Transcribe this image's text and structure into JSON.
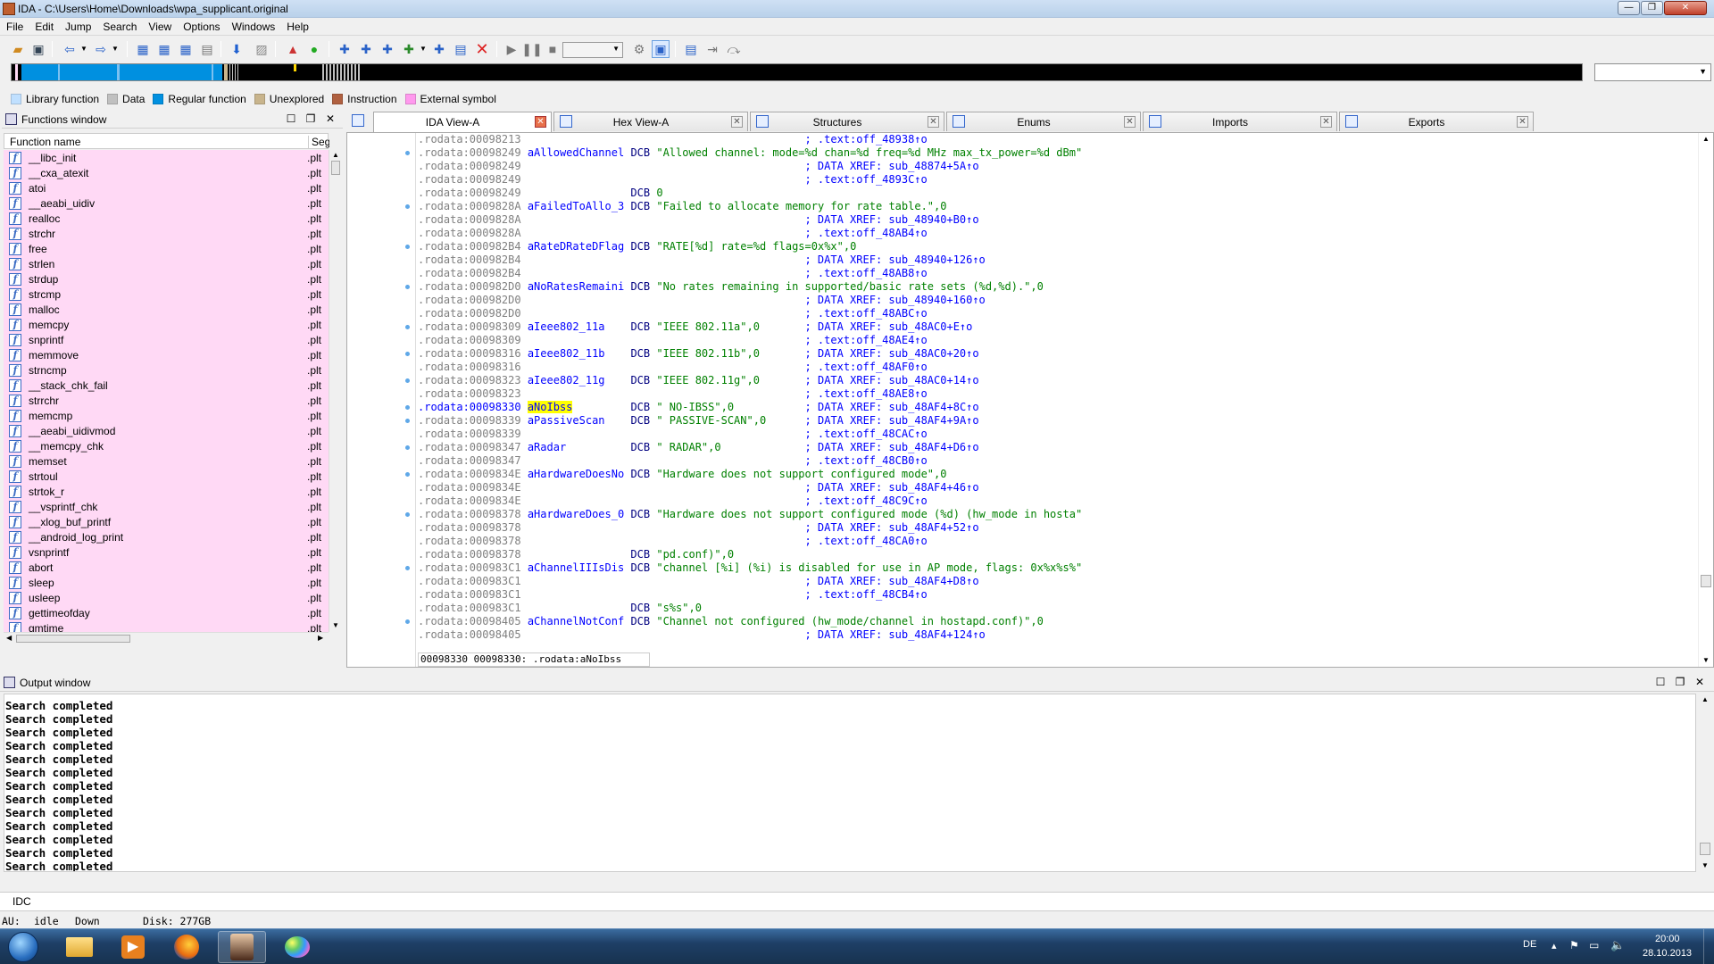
{
  "window": {
    "title": "IDA - C:\\Users\\Home\\Downloads\\wpa_supplicant.original",
    "minimize": "—",
    "maximize": "❐",
    "close": "✕"
  },
  "menu": [
    "File",
    "Edit",
    "Jump",
    "Search",
    "View",
    "Options",
    "Windows",
    "Help"
  ],
  "legend": [
    {
      "label": "Library function",
      "color": "#c0e0ff"
    },
    {
      "label": "Data",
      "color": "#c0c0c0"
    },
    {
      "label": "Regular function",
      "color": "#0090e0"
    },
    {
      "label": "Unexplored",
      "color": "#c8b48c"
    },
    {
      "label": "Instruction",
      "color": "#b06040"
    },
    {
      "label": "External symbol",
      "color": "#ff99ee"
    }
  ],
  "functions_panel": {
    "title": "Functions window",
    "col_name": "Function name",
    "col_segment": "Segm",
    "items": [
      {
        "name": "__libc_init",
        "seg": ".plt"
      },
      {
        "name": "__cxa_atexit",
        "seg": ".plt"
      },
      {
        "name": "atoi",
        "seg": ".plt"
      },
      {
        "name": "__aeabi_uidiv",
        "seg": ".plt"
      },
      {
        "name": "realloc",
        "seg": ".plt"
      },
      {
        "name": "strchr",
        "seg": ".plt"
      },
      {
        "name": "free",
        "seg": ".plt"
      },
      {
        "name": "strlen",
        "seg": ".plt"
      },
      {
        "name": "strdup",
        "seg": ".plt"
      },
      {
        "name": "strcmp",
        "seg": ".plt"
      },
      {
        "name": "malloc",
        "seg": ".plt"
      },
      {
        "name": "memcpy",
        "seg": ".plt"
      },
      {
        "name": "snprintf",
        "seg": ".plt"
      },
      {
        "name": "memmove",
        "seg": ".plt"
      },
      {
        "name": "strncmp",
        "seg": ".plt"
      },
      {
        "name": "__stack_chk_fail",
        "seg": ".plt"
      },
      {
        "name": "strrchr",
        "seg": ".plt"
      },
      {
        "name": "memcmp",
        "seg": ".plt"
      },
      {
        "name": "__aeabi_uidivmod",
        "seg": ".plt"
      },
      {
        "name": "__memcpy_chk",
        "seg": ".plt"
      },
      {
        "name": "memset",
        "seg": ".plt"
      },
      {
        "name": "strtoul",
        "seg": ".plt"
      },
      {
        "name": "strtok_r",
        "seg": ".plt"
      },
      {
        "name": "__vsprintf_chk",
        "seg": ".plt"
      },
      {
        "name": "__xlog_buf_printf",
        "seg": ".plt"
      },
      {
        "name": "__android_log_print",
        "seg": ".plt"
      },
      {
        "name": "vsnprintf",
        "seg": ".plt"
      },
      {
        "name": "abort",
        "seg": ".plt"
      },
      {
        "name": "sleep",
        "seg": ".plt"
      },
      {
        "name": "usleep",
        "seg": ".plt"
      },
      {
        "name": "gettimeofday",
        "seg": ".plt"
      },
      {
        "name": "gmtime",
        "seg": ".plt"
      }
    ]
  },
  "tabs": [
    {
      "label": "IDA View-A",
      "active": true
    },
    {
      "label": "Hex View-A",
      "active": false
    },
    {
      "label": "Structures",
      "active": false
    },
    {
      "label": "Enums",
      "active": false
    },
    {
      "label": "Imports",
      "active": false
    },
    {
      "label": "Exports",
      "active": false
    }
  ],
  "ida_view": {
    "status": "00098330 00098330: .rodata:aNoIbss",
    "lines": [
      {
        "addr": ".rodata:00098213",
        "name": "",
        "op": "",
        "val": "",
        "cmt": "; .text:off_48938↑o"
      },
      {
        "addr": ".rodata:00098249",
        "name": "aAllowedChannel",
        "op": "DCB",
        "val": "\"Allowed channel: mode=%d chan=%d freq=%d MHz max_tx_power=%d dBm\"",
        "cmt": "",
        "dot": true
      },
      {
        "addr": ".rodata:00098249",
        "name": "",
        "op": "",
        "val": "",
        "cmt": "; DATA XREF: sub_48874+5A↑o"
      },
      {
        "addr": ".rodata:00098249",
        "name": "",
        "op": "",
        "val": "",
        "cmt": "; .text:off_4893C↑o"
      },
      {
        "addr": ".rodata:00098249",
        "name": "",
        "op": "DCB",
        "val": "0",
        "cmt": ""
      },
      {
        "addr": ".rodata:0009828A",
        "name": "aFailedToAllo_3",
        "op": "DCB",
        "val": "\"Failed to allocate memory for rate table.\",0",
        "cmt": "",
        "dot": true
      },
      {
        "addr": ".rodata:0009828A",
        "name": "",
        "op": "",
        "val": "",
        "cmt": "; DATA XREF: sub_48940+B0↑o"
      },
      {
        "addr": ".rodata:0009828A",
        "name": "",
        "op": "",
        "val": "",
        "cmt": "; .text:off_48AB4↑o"
      },
      {
        "addr": ".rodata:000982B4",
        "name": "aRateDRateDFlag",
        "op": "DCB",
        "val": "\"RATE[%d] rate=%d flags=0x%x\",0",
        "cmt": "",
        "dot": true
      },
      {
        "addr": ".rodata:000982B4",
        "name": "",
        "op": "",
        "val": "",
        "cmt": "; DATA XREF: sub_48940+126↑o"
      },
      {
        "addr": ".rodata:000982B4",
        "name": "",
        "op": "",
        "val": "",
        "cmt": "; .text:off_48AB8↑o"
      },
      {
        "addr": ".rodata:000982D0",
        "name": "aNoRatesRemaini",
        "op": "DCB",
        "val": "\"No rates remaining in supported/basic rate sets (%d,%d).\",0",
        "cmt": "",
        "dot": true
      },
      {
        "addr": ".rodata:000982D0",
        "name": "",
        "op": "",
        "val": "",
        "cmt": "; DATA XREF: sub_48940+160↑o"
      },
      {
        "addr": ".rodata:000982D0",
        "name": "",
        "op": "",
        "val": "",
        "cmt": "; .text:off_48ABC↑o"
      },
      {
        "addr": ".rodata:00098309",
        "name": "aIeee802_11a",
        "op": "DCB",
        "val": "\"IEEE 802.11a\",0",
        "cmt": "; DATA XREF: sub_48AC0+E↑o",
        "dot": true
      },
      {
        "addr": ".rodata:00098309",
        "name": "",
        "op": "",
        "val": "",
        "cmt": "; .text:off_48AE4↑o"
      },
      {
        "addr": ".rodata:00098316",
        "name": "aIeee802_11b",
        "op": "DCB",
        "val": "\"IEEE 802.11b\",0",
        "cmt": "; DATA XREF: sub_48AC0+20↑o",
        "dot": true
      },
      {
        "addr": ".rodata:00098316",
        "name": "",
        "op": "",
        "val": "",
        "cmt": "; .text:off_48AF0↑o"
      },
      {
        "addr": ".rodata:00098323",
        "name": "aIeee802_11g",
        "op": "DCB",
        "val": "\"IEEE 802.11g\",0",
        "cmt": "; DATA XREF: sub_48AC0+14↑o",
        "dot": true
      },
      {
        "addr": ".rodata:00098323",
        "name": "",
        "op": "",
        "val": "",
        "cmt": "; .text:off_48AE8↑o"
      },
      {
        "addr": ".rodata:00098330",
        "name": "aNoIbss",
        "op": "DCB",
        "val": "\" NO-IBSS\",0",
        "cmt": "; DATA XREF: sub_48AF4+8C↑o",
        "dot": true,
        "hl": true
      },
      {
        "addr": ".rodata:00098339",
        "name": "aPassiveScan",
        "op": "DCB",
        "val": "\" PASSIVE-SCAN\",0",
        "cmt": "; DATA XREF: sub_48AF4+9A↑o",
        "dot": true
      },
      {
        "addr": ".rodata:00098339",
        "name": "",
        "op": "",
        "val": "",
        "cmt": "; .text:off_48CAC↑o"
      },
      {
        "addr": ".rodata:00098347",
        "name": "aRadar",
        "op": "DCB",
        "val": "\" RADAR\",0",
        "cmt": "; DATA XREF: sub_48AF4+D6↑o",
        "dot": true
      },
      {
        "addr": ".rodata:00098347",
        "name": "",
        "op": "",
        "val": "",
        "cmt": "; .text:off_48CB0↑o"
      },
      {
        "addr": ".rodata:0009834E",
        "name": "aHardwareDoesNo",
        "op": "DCB",
        "val": "\"Hardware does not support configured mode\",0",
        "cmt": "",
        "dot": true
      },
      {
        "addr": ".rodata:0009834E",
        "name": "",
        "op": "",
        "val": "",
        "cmt": "; DATA XREF: sub_48AF4+46↑o"
      },
      {
        "addr": ".rodata:0009834E",
        "name": "",
        "op": "",
        "val": "",
        "cmt": "; .text:off_48C9C↑o"
      },
      {
        "addr": ".rodata:00098378",
        "name": "aHardwareDoes_0",
        "op": "DCB",
        "val": "\"Hardware does not support configured mode (%d) (hw_mode in hosta\"",
        "cmt": "",
        "dot": true
      },
      {
        "addr": ".rodata:00098378",
        "name": "",
        "op": "",
        "val": "",
        "cmt": "; DATA XREF: sub_48AF4+52↑o"
      },
      {
        "addr": ".rodata:00098378",
        "name": "",
        "op": "",
        "val": "",
        "cmt": "; .text:off_48CA0↑o"
      },
      {
        "addr": ".rodata:00098378",
        "name": "",
        "op": "DCB",
        "val": "\"pd.conf)\",0",
        "cmt": ""
      },
      {
        "addr": ".rodata:000983C1",
        "name": "aChannelIIIsDis",
        "op": "DCB",
        "val": "\"channel [%i] (%i) is disabled for use in AP mode, flags: 0x%x%s%\"",
        "cmt": "",
        "dot": true
      },
      {
        "addr": ".rodata:000983C1",
        "name": "",
        "op": "",
        "val": "",
        "cmt": "; DATA XREF: sub_48AF4+D8↑o"
      },
      {
        "addr": ".rodata:000983C1",
        "name": "",
        "op": "",
        "val": "",
        "cmt": "; .text:off_48CB4↑o"
      },
      {
        "addr": ".rodata:000983C1",
        "name": "",
        "op": "DCB",
        "val": "\"s%s\",0",
        "cmt": ""
      },
      {
        "addr": ".rodata:00098405",
        "name": "aChannelNotConf",
        "op": "DCB",
        "val": "\"Channel not configured (hw_mode/channel in hostapd.conf)\",0",
        "cmt": "",
        "dot": true
      },
      {
        "addr": ".rodata:00098405",
        "name": "",
        "op": "",
        "val": "",
        "cmt": "; DATA XREF: sub_48AF4+124↑o"
      }
    ]
  },
  "output_panel": {
    "title": "Output window",
    "lines": [
      "Search completed",
      "Search completed",
      "Search completed",
      "Search completed",
      "Search completed",
      "Search completed",
      "Search completed",
      "Search completed",
      "Search completed",
      "Search completed",
      "Search completed",
      "Search completed",
      "Search completed",
      "Search completed",
      "Search completed"
    ]
  },
  "idc_label": "IDC",
  "statusbar": {
    "au": "AU:",
    "state": "idle",
    "dir": "Down",
    "disk": "Disk: 277GB"
  },
  "taskbar": {
    "lang": "DE",
    "time": "20:00",
    "date": "28.10.2013"
  }
}
